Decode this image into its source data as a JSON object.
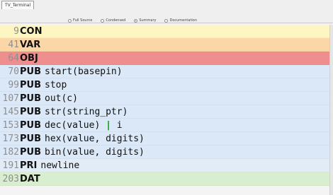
{
  "window": {
    "tab_label": "TV_Terminal"
  },
  "view_modes": [
    {
      "label": "Full Source",
      "selected": false
    },
    {
      "label": "Condensed",
      "selected": false
    },
    {
      "label": "Summary",
      "selected": true
    },
    {
      "label": "Documentation",
      "selected": false
    }
  ],
  "colors": {
    "con": "#fdf6c3",
    "var": "#fbd6a6",
    "obj": "#ee8e8e",
    "pub": "#dbe8f8",
    "pri": "#e2ecf6",
    "dat": "#d9edcf"
  },
  "rows": [
    {
      "line": "9",
      "keyword": "CON",
      "code": "",
      "type": "con"
    },
    {
      "line": "41",
      "keyword": "VAR",
      "code": "",
      "type": "var"
    },
    {
      "line": "64",
      "keyword": "OBJ",
      "code": "",
      "type": "obj"
    },
    {
      "line": "70",
      "keyword": "PUB",
      "code": "start(basepin)",
      "type": "pub"
    },
    {
      "line": "99",
      "keyword": "PUB",
      "code": "stop",
      "type": "pub"
    },
    {
      "line": "107",
      "keyword": "PUB",
      "code": "out(c)",
      "type": "pub"
    },
    {
      "line": "145",
      "keyword": "PUB",
      "code": "str(string_ptr)",
      "type": "pub"
    },
    {
      "line": "153",
      "keyword": "PUB",
      "code": "dec(value)",
      "code_tail": "i",
      "type": "pub"
    },
    {
      "line": "173",
      "keyword": "PUB",
      "code": "hex(value, digits)",
      "type": "pub"
    },
    {
      "line": "182",
      "keyword": "PUB",
      "code": "bin(value, digits)",
      "type": "pub"
    },
    {
      "line": "191",
      "keyword": "PRI",
      "code": "newline",
      "type": "pri"
    },
    {
      "line": "203",
      "keyword": "DAT",
      "code": "",
      "type": "dat"
    }
  ]
}
